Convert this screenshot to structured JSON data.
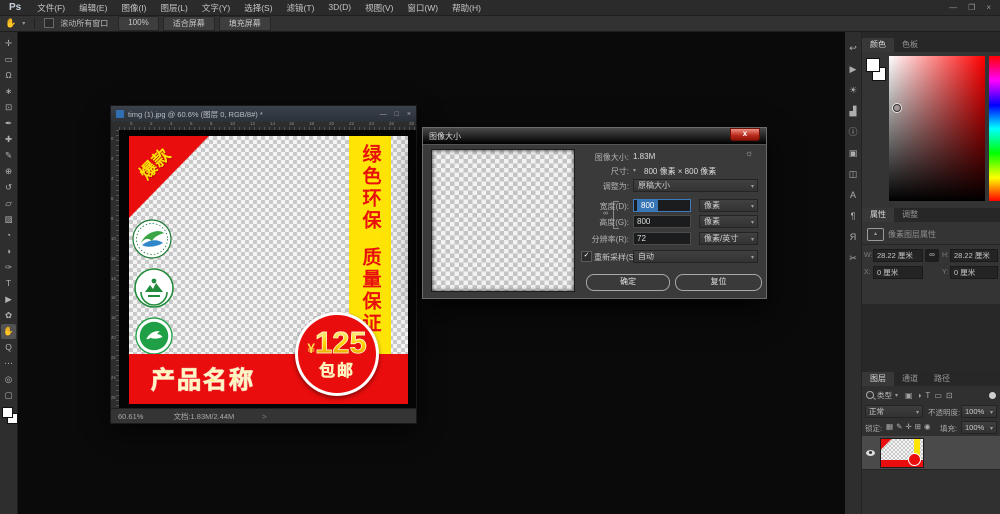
{
  "icons": {
    "caret": "▾",
    "gear": "☼",
    "check": "✓",
    "status_caret": ">"
  },
  "app": {
    "logo": "Ps",
    "menu_items": [
      "文件(F)",
      "编辑(E)",
      "图像(I)",
      "图层(L)",
      "文字(Y)",
      "选择(S)",
      "滤镜(T)",
      "3D(D)",
      "视图(V)",
      "窗口(W)",
      "帮助(H)"
    ],
    "window_controls": [
      {
        "name": "app-minimize-button",
        "glyph": "—"
      },
      {
        "name": "app-restore-button",
        "glyph": "❐"
      },
      {
        "name": "app-close-button",
        "glyph": "×"
      }
    ]
  },
  "options_bar": {
    "tool_glyph": "✋",
    "scroll_all_windows": "滚动所有窗口",
    "buttons": [
      {
        "name": "zoom-100-button",
        "label": "100%"
      },
      {
        "name": "fit-screen-button",
        "label": "适合屏幕"
      },
      {
        "name": "fill-screen-button",
        "label": "填充屏幕"
      }
    ]
  },
  "toolbar": {
    "tools": [
      {
        "name": "move-tool",
        "glyph": "✛"
      },
      {
        "name": "marquee-tool",
        "glyph": "▭"
      },
      {
        "name": "lasso-tool",
        "glyph": "Ω"
      },
      {
        "name": "quick-selection-tool",
        "glyph": "∗"
      },
      {
        "name": "crop-tool",
        "glyph": "⊡"
      },
      {
        "name": "eyedropper-tool",
        "glyph": "✒"
      },
      {
        "name": "healing-brush-tool",
        "glyph": "✚"
      },
      {
        "name": "brush-tool",
        "glyph": "✎"
      },
      {
        "name": "clone-stamp-tool",
        "glyph": "⊕"
      },
      {
        "name": "history-brush-tool",
        "glyph": "↺"
      },
      {
        "name": "eraser-tool",
        "glyph": "▱"
      },
      {
        "name": "gradient-tool",
        "glyph": "▨"
      },
      {
        "name": "blur-tool",
        "glyph": "◔"
      },
      {
        "name": "dodge-tool",
        "glyph": "◑"
      },
      {
        "name": "pen-tool",
        "glyph": "✑"
      },
      {
        "name": "type-tool",
        "glyph": "T"
      },
      {
        "name": "path-selection-tool",
        "glyph": "▶"
      },
      {
        "name": "shape-tool",
        "glyph": "✿"
      },
      {
        "name": "hand-tool",
        "glyph": "✋",
        "active": true
      },
      {
        "name": "zoom-tool",
        "glyph": "Q"
      },
      {
        "name": "edit-toolbar-button",
        "glyph": "⋯"
      },
      {
        "name": "quick-mask-button",
        "glyph": "◎"
      },
      {
        "name": "screen-mode-button",
        "glyph": "▢"
      }
    ]
  },
  "dock_icons": [
    {
      "name": "history-panel-icon",
      "glyph": "↩"
    },
    {
      "name": "actions-panel-icon",
      "glyph": "▶"
    },
    {
      "name": "adjustments-panel-icon",
      "glyph": "☀"
    },
    {
      "name": "histogram-panel-icon",
      "glyph": "▟"
    },
    {
      "name": "info-panel-icon",
      "glyph": "ⓘ"
    },
    {
      "name": "clone-source-panel-icon",
      "glyph": "▣"
    },
    {
      "name": "device-preview-panel-icon",
      "glyph": "◫"
    },
    {
      "name": "character-panel-icon",
      "glyph": "A"
    },
    {
      "name": "paragraph-panel-icon",
      "glyph": "¶"
    },
    {
      "name": "glyphs-panel-icon",
      "glyph": "Я"
    },
    {
      "name": "tool-presets-panel-icon",
      "glyph": "✂"
    }
  ],
  "doc": {
    "title": "timg (1).jpg @ 60.6% (图层 0, RGB/8#) *",
    "controls": [
      {
        "name": "doc-minimize-button",
        "glyph": "—"
      },
      {
        "name": "doc-maximize-button",
        "glyph": "□"
      },
      {
        "name": "doc-close-button",
        "glyph": "×"
      }
    ],
    "ruler_h": [
      "0",
      "2",
      "4",
      "6",
      "8",
      "10",
      "12",
      "14",
      "16",
      "18",
      "20",
      "22",
      "24",
      "26",
      "28"
    ],
    "ruler_v": [
      "0",
      "2",
      "4",
      "6",
      "8",
      "10",
      "12",
      "14",
      "16",
      "18",
      "20",
      "22",
      "24",
      "26"
    ],
    "status_zoom": "60.61%",
    "status_doc": "文档:1.83M/2.44M"
  },
  "artwork": {
    "burst": "爆款",
    "banner_line1": "绿色环保",
    "banner_line2": "质量保证",
    "product_name": "产品名称",
    "currency": "¥",
    "price": "125",
    "shipping": "包邮",
    "colors": {
      "red": "#ea0d0d",
      "yellow": "#ffe506",
      "gold": "#ffd400"
    }
  },
  "dialog": {
    "title": "图像大小",
    "close": "x",
    "image_size_label": "图像大小:",
    "image_size_value": "1.83M",
    "dimensions_label": "尺寸:",
    "dimensions_value": "800 像素 × 800 像素",
    "fit_to_label": "调整为:",
    "fit_to_value": "原稿大小",
    "width_label": "宽度(D):",
    "width_value": "800",
    "width_unit": "像素",
    "height_label": "高度(G):",
    "height_value": "800",
    "height_unit": "像素",
    "resolution_label": "分辨率(R):",
    "resolution_value": "72",
    "resolution_unit": "像素/英寸",
    "resample_label": "重新采样(S):",
    "resample_value": "自动",
    "ok": "确定",
    "reset": "复位"
  },
  "panels": {
    "color": {
      "tab_color": "颜色",
      "tab_swatches": "色板"
    },
    "properties": {
      "tab_properties": "属性",
      "tab_adjustments": "调整",
      "type_label": "像素图层属性",
      "w_label": "W:",
      "w_value": "28.22 厘米",
      "h_label": "H:",
      "h_value": "28.22 厘米",
      "link_glyph": "∞",
      "x_label": "X:",
      "x_value": "0 厘米",
      "y_label": "Y:",
      "y_value": "0 厘米"
    },
    "layers": {
      "tab_layers": "图层",
      "tab_channels": "通道",
      "tab_paths": "路径",
      "filter_label": "类型",
      "filter_icons": [
        {
          "name": "filter-pixel-layers-icon",
          "glyph": "▣"
        },
        {
          "name": "filter-adjustment-layers-icon",
          "glyph": "◑"
        },
        {
          "name": "filter-type-layers-icon",
          "glyph": "T"
        },
        {
          "name": "filter-shape-layers-icon",
          "glyph": "▭"
        },
        {
          "name": "filter-smart-objects-icon",
          "glyph": "⊡"
        }
      ],
      "blend_mode": "正常",
      "opacity_label": "不透明度:",
      "opacity_value": "100%",
      "lock_label": "锁定:",
      "lock_icons": [
        {
          "name": "lock-transparent-pixels-icon",
          "glyph": "▦"
        },
        {
          "name": "lock-image-pixels-icon",
          "glyph": "✎"
        },
        {
          "name": "lock-position-icon",
          "glyph": "✛"
        },
        {
          "name": "lock-artboard-icon",
          "glyph": "⊞"
        },
        {
          "name": "lock-all-icon",
          "glyph": "◉"
        }
      ],
      "fill_label": "填充:",
      "fill_value": "100%"
    }
  }
}
